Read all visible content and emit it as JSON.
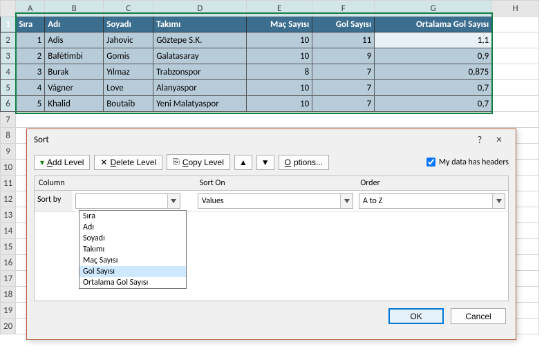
{
  "columns": [
    "A",
    "B",
    "C",
    "D",
    "E",
    "F",
    "G",
    "H"
  ],
  "rows": [
    "1",
    "2",
    "3",
    "4",
    "5",
    "6",
    "7",
    "8",
    "9",
    "10",
    "11",
    "12",
    "13",
    "14",
    "15",
    "16",
    "17",
    "18",
    "19",
    "20"
  ],
  "headers": {
    "A": "Sıra",
    "B": "Adı",
    "C": "Soyadı",
    "D": "Takımı",
    "E": "Maç Sayısı",
    "F": "Gol Sayısı",
    "G": "Ortalama Gol Sayısı"
  },
  "data": [
    {
      "sira": "1",
      "adi": "Adis",
      "soy": "Jahovic",
      "tak": "Göztepe S.K.",
      "mac": "10",
      "gol": "11",
      "ort": "1,1"
    },
    {
      "sira": "2",
      "adi": "Bafétimbi",
      "soy": "Gomis",
      "tak": "Galatasaray",
      "mac": "10",
      "gol": "9",
      "ort": "0,9"
    },
    {
      "sira": "3",
      "adi": "Burak",
      "soy": "Yılmaz",
      "tak": "Trabzonspor",
      "mac": "8",
      "gol": "7",
      "ort": "0,875"
    },
    {
      "sira": "4",
      "adi": "Vágner",
      "soy": "Love",
      "tak": "Alanyaspor",
      "mac": "10",
      "gol": "7",
      "ort": "0,7"
    },
    {
      "sira": "5",
      "adi": "Khalid",
      "soy": "Boutaib",
      "tak": "Yeni Malatyaspor",
      "mac": "10",
      "gol": "7",
      "ort": "0,7"
    }
  ],
  "dialog": {
    "title": "Sort",
    "help": "?",
    "close": "×",
    "btn_add": "Add Level",
    "btn_del": "Delete Level",
    "btn_copy": "Copy Level",
    "btn_opts": "Options...",
    "chk_headers": "My data has headers",
    "col_column": "Column",
    "col_sorton": "Sort On",
    "col_order": "Order",
    "row_label": "Sort by",
    "sorton_val": "Values",
    "order_val": "A to Z",
    "ok": "OK",
    "cancel": "Cancel",
    "dropdown": [
      "Sıra",
      "Adı",
      "Soyadı",
      "Takımı",
      "Maç Sayısı",
      "Gol Sayısı",
      "Ortalama Gol Sayısı"
    ],
    "dropdown_hl": "Gol Sayısı"
  }
}
